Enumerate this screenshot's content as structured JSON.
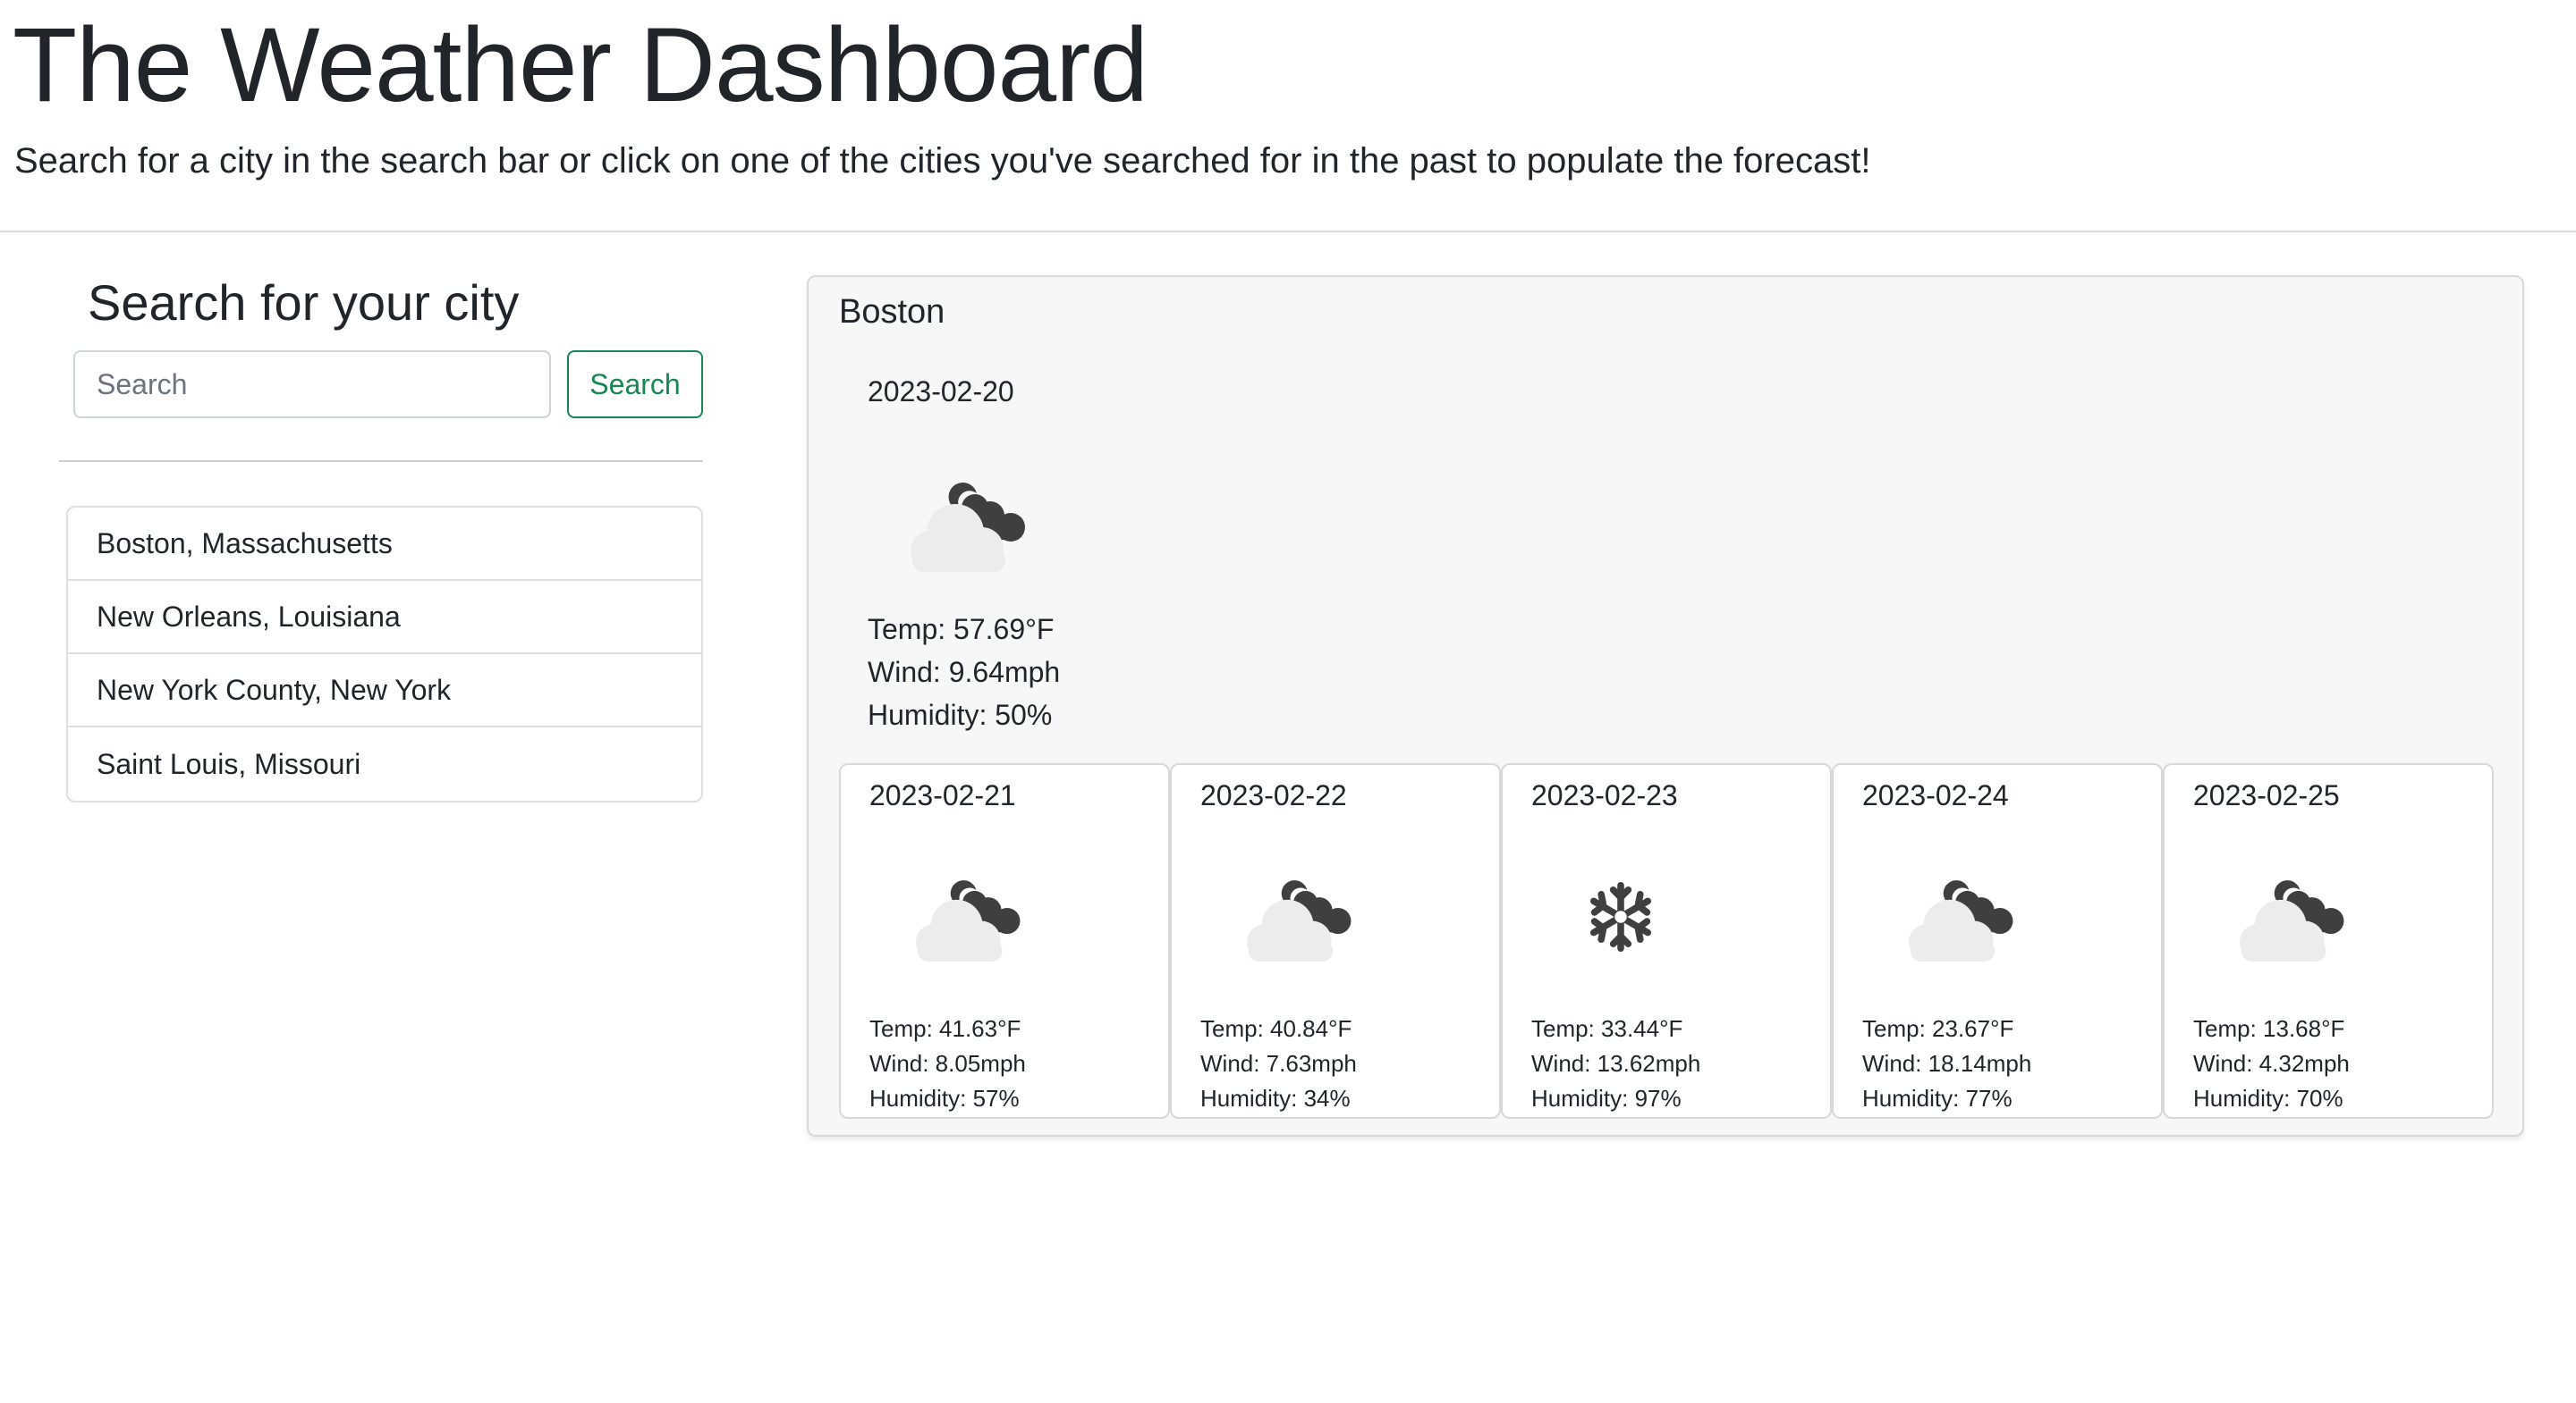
{
  "header": {
    "title": "The Weather Dashboard",
    "subtitle": "Search for a city in the search bar or click on one of the cities you've searched for in the past to populate the forecast!"
  },
  "sidebar": {
    "title": "Search for your city",
    "search_placeholder": "Search",
    "search_button_label": "Search",
    "history": [
      {
        "label": "Boston, Massachusetts"
      },
      {
        "label": "New Orleans, Louisiana"
      },
      {
        "label": "New York County, New York"
      },
      {
        "label": "Saint Louis, Missouri"
      }
    ]
  },
  "forecast": {
    "city": "Boston",
    "today": {
      "date": "2023-02-20",
      "icon": "partly-cloudy-night-icon",
      "temp": "Temp: 57.69°F",
      "wind": "Wind: 9.64mph",
      "humidity": "Humidity: 50%"
    },
    "days": [
      {
        "date": "2023-02-21",
        "icon": "partly-cloudy-night-icon",
        "temp": "Temp: 41.63°F",
        "wind": "Wind: 8.05mph",
        "humidity": "Humidity: 57%"
      },
      {
        "date": "2023-02-22",
        "icon": "partly-cloudy-night-icon",
        "temp": "Temp: 40.84°F",
        "wind": "Wind: 7.63mph",
        "humidity": "Humidity: 34%"
      },
      {
        "date": "2023-02-23",
        "icon": "snowflake-icon",
        "temp": "Temp: 33.44°F",
        "wind": "Wind: 13.62mph",
        "humidity": "Humidity: 97%"
      },
      {
        "date": "2023-02-24",
        "icon": "partly-cloudy-night-icon",
        "temp": "Temp: 23.67°F",
        "wind": "Wind: 18.14mph",
        "humidity": "Humidity: 77%"
      },
      {
        "date": "2023-02-25",
        "icon": "partly-cloudy-night-icon",
        "temp": "Temp: 13.68°F",
        "wind": "Wind: 4.32mph",
        "humidity": "Humidity: 70%"
      }
    ]
  },
  "colors": {
    "accent_green": "#198754",
    "panel_bg": "#f7f7f7",
    "icon_dark": "#3f3f3f",
    "icon_cloud": "#ececec"
  }
}
